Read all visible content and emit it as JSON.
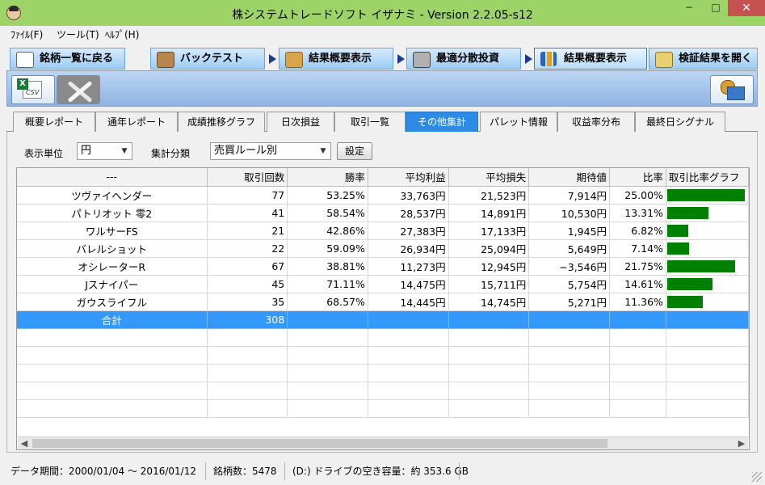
{
  "window": {
    "title": "株システムトレードソフト イザナミ - Version 2.2.05-s12",
    "min_glyph": "−",
    "max_glyph": "□",
    "close_glyph": "✕"
  },
  "menu": {
    "items": [
      "ﾌｧｲﾙ(F)",
      "ツール(T)",
      "ﾍﾙﾌﾟ(H)"
    ]
  },
  "main_tabs": [
    {
      "label": "銘柄一覧に戻る",
      "icon": "eye-icon"
    },
    {
      "label": "バックテスト",
      "icon": "bag-icon"
    },
    {
      "label": "結果概要表示",
      "icon": "money-bag-icon"
    },
    {
      "label": "最適分散投資",
      "icon": "calculator-icon"
    },
    {
      "label": "結果概要表示",
      "icon": "bar-chart-icon"
    },
    {
      "label": "検証結果を開く",
      "icon": "open-file-icon"
    }
  ],
  "sub_tabs": [
    "概要レポート",
    "通年レポート",
    "成績推移グラフ",
    "日次損益",
    "取引一覧",
    "その他集計",
    "パレット情報",
    "収益率分布",
    "最終日シグナル"
  ],
  "controls": {
    "unit_label": "表示単位",
    "unit_value": "円",
    "category_label": "集計分類",
    "category_value": "売買ルール別",
    "settings_button": "設定"
  },
  "table": {
    "headers": [
      "---",
      "取引回数",
      "勝率",
      "平均利益",
      "平均損失",
      "期待値",
      "比率",
      "取引比率グラフ"
    ],
    "rows": [
      {
        "name": "ツヴァイヘンダー",
        "trades": "77",
        "win_rate": "53.25%",
        "avg_profit": "33,763円",
        "avg_loss": "21,523円",
        "expected": "7,914円",
        "ratio": "25.00%",
        "ratio_value": 25.0
      },
      {
        "name": "パトリオット 零2",
        "trades": "41",
        "win_rate": "58.54%",
        "avg_profit": "28,537円",
        "avg_loss": "14,891円",
        "expected": "10,530円",
        "ratio": "13.31%",
        "ratio_value": 13.31
      },
      {
        "name": "ワルサーFS",
        "trades": "21",
        "win_rate": "42.86%",
        "avg_profit": "27,383円",
        "avg_loss": "17,133円",
        "expected": "1,945円",
        "ratio": "6.82%",
        "ratio_value": 6.82
      },
      {
        "name": "バレルショット",
        "trades": "22",
        "win_rate": "59.09%",
        "avg_profit": "26,934円",
        "avg_loss": "25,094円",
        "expected": "5,649円",
        "ratio": "7.14%",
        "ratio_value": 7.14
      },
      {
        "name": "オシレーターR",
        "trades": "67",
        "win_rate": "38.81%",
        "avg_profit": "11,273円",
        "avg_loss": "12,945円",
        "expected": "−3,546円",
        "ratio": "21.75%",
        "ratio_value": 21.75
      },
      {
        "name": "Jスナイパー",
        "trades": "45",
        "win_rate": "71.11%",
        "avg_profit": "14,475円",
        "avg_loss": "15,711円",
        "expected": "5,754円",
        "ratio": "14.61%",
        "ratio_value": 14.61
      },
      {
        "name": "ガウスライフル",
        "trades": "35",
        "win_rate": "68.57%",
        "avg_profit": "14,445円",
        "avg_loss": "14,745円",
        "expected": "5,271円",
        "ratio": "11.36%",
        "ratio_value": 11.36
      }
    ],
    "total": {
      "name": "合計",
      "trades": "308"
    }
  },
  "status": {
    "period": "データ期間：2000/01/04 〜 2016/01/12",
    "symbols": "銘柄数：5478",
    "disk": "(D:) ドライブの空き容量：約 353.6 GB"
  },
  "colors": {
    "titlebar": "#9ed368",
    "accent": "#2d8ae5",
    "selection": "#3399ff",
    "bar": "#008000",
    "close": "#c75050"
  }
}
